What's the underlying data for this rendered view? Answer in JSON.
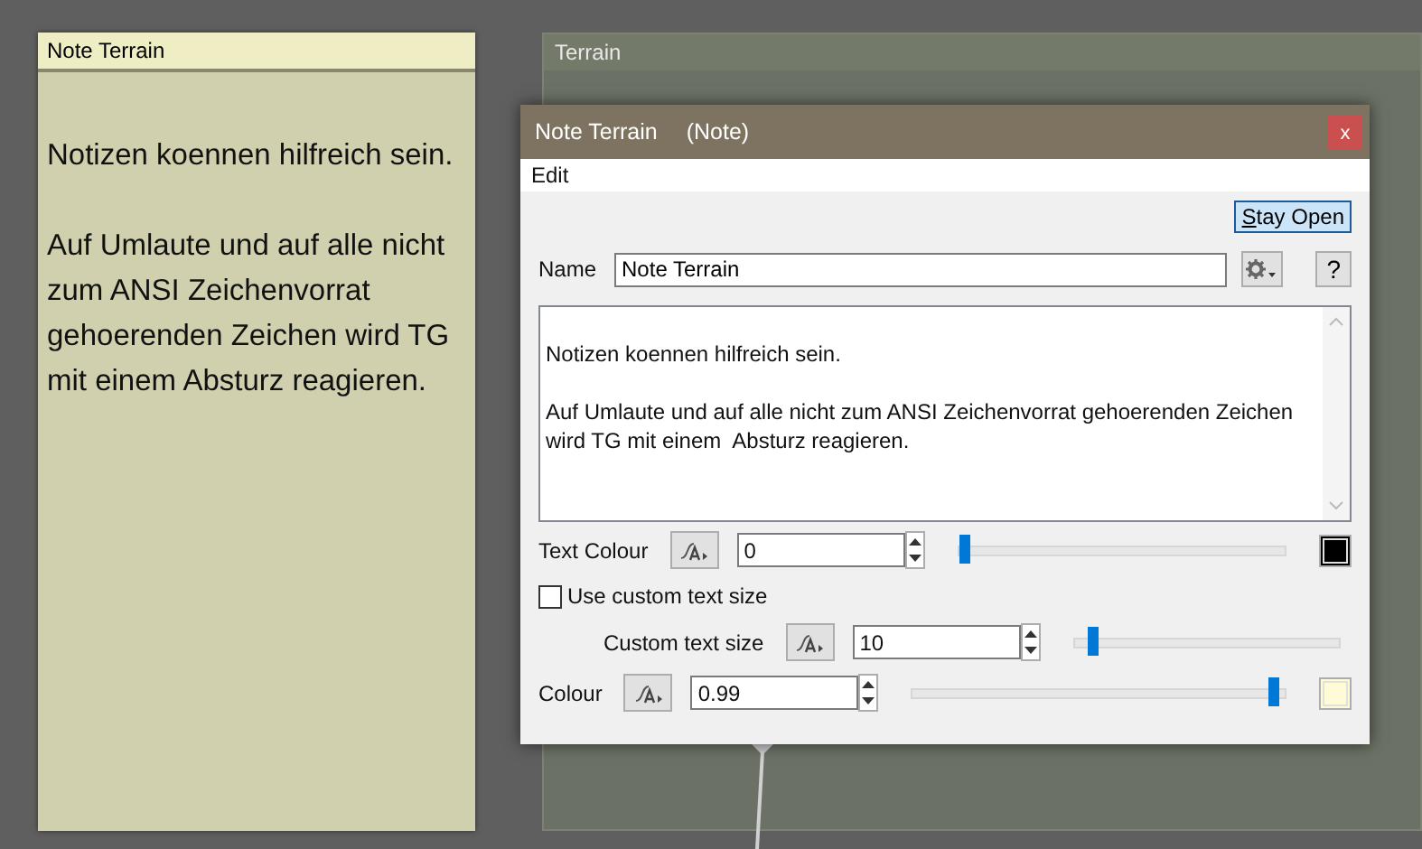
{
  "note_card": {
    "title": "Note Terrain",
    "paragraphs": [
      "Notizen koennen hilfreich sein.",
      "Auf Umlaute und auf alle nicht zum ANSI Zeichenvorrat gehoerenden Zeichen wird TG mit einem Absturz reagieren."
    ]
  },
  "terrain_panel": {
    "title": "Terrain"
  },
  "dialog": {
    "title": "Note Terrain",
    "subtitle": "(Note)",
    "close": "x",
    "menu": [
      "Edit"
    ],
    "stay_open": {
      "label": "Stay Open",
      "selected": true
    },
    "name_label": "Name",
    "name_value": "Note Terrain",
    "help": "?",
    "text_paragraphs": [
      "Notizen koennen hilfreich sein.",
      "Auf Umlaute und auf alle nicht zum ANSI Zeichenvorrat gehoerenden Zeichen wird TG mit einem  Absturz reagieren."
    ],
    "rows": [
      {
        "kind": "slider",
        "label": "Text Colour",
        "value": "0",
        "level": 0.02,
        "color": "#000000",
        "indented": false
      },
      {
        "kind": "checkbox",
        "label": "Use custom text size",
        "checked": false
      },
      {
        "kind": "slider",
        "label": "Custom text size",
        "value": "10",
        "level": 0.07,
        "indented": true
      },
      {
        "kind": "slider",
        "label": "Colour",
        "value": "0.99",
        "level": 0.97,
        "color": "#fffbd6",
        "indented": false
      }
    ]
  }
}
